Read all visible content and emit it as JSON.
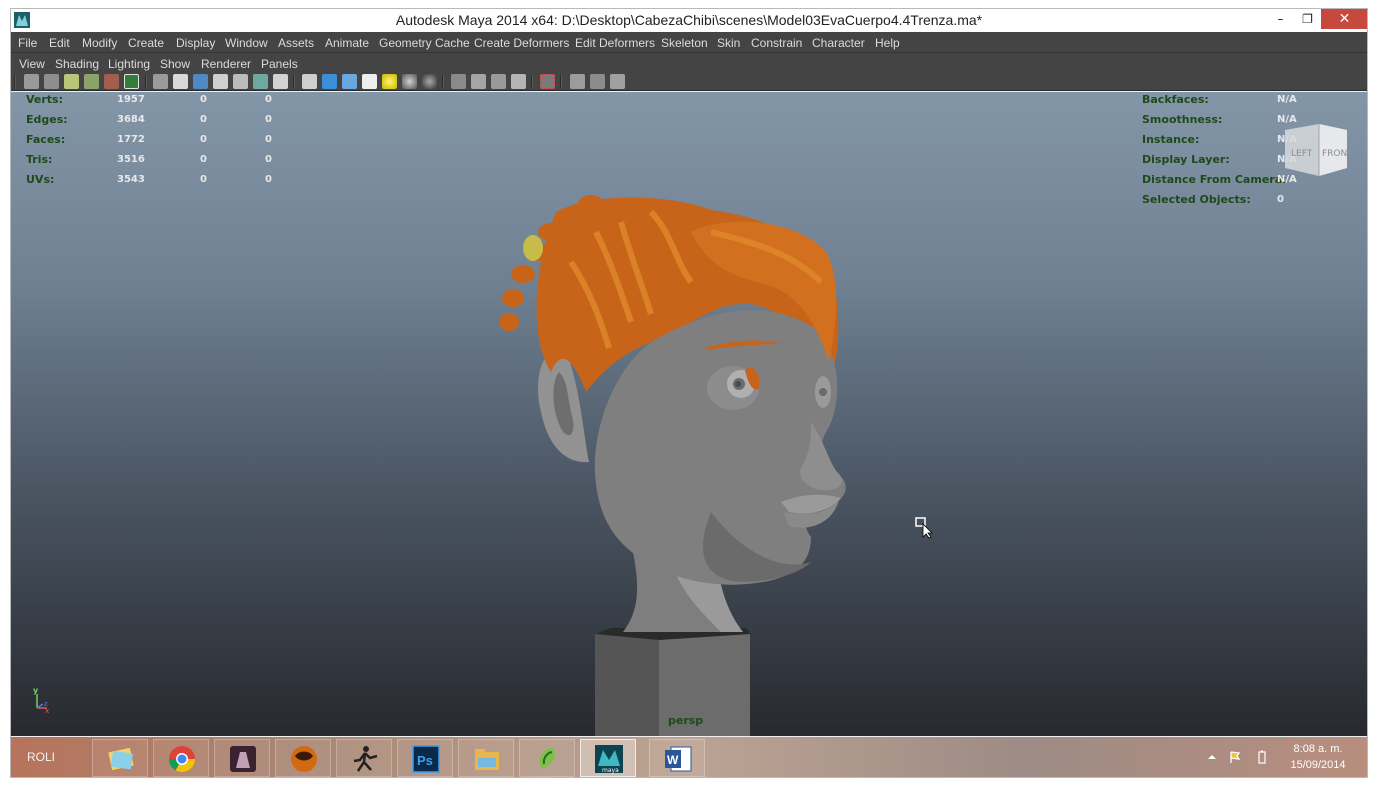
{
  "window": {
    "title": "Autodesk Maya 2014 x64: D:\\Desktop\\CabezaChibi\\scenes\\Model03EvaCuerpo4.4Trenza.ma*",
    "minimize": "–",
    "maximize": "❐",
    "close": "✕"
  },
  "menubar": {
    "items": [
      "File",
      "Edit",
      "Modify",
      "Create",
      "Display",
      "Window",
      "Assets",
      "Animate",
      "Geometry Cache",
      "Create Deformers",
      "Edit Deformers",
      "Skeleton",
      "Skin",
      "Constrain",
      "Character",
      "Help"
    ]
  },
  "panel_menu": {
    "items": [
      "View",
      "Shading",
      "Lighting",
      "Show",
      "Renderer",
      "Panels"
    ]
  },
  "hud_left": {
    "rows": [
      {
        "label": "Verts:",
        "v1": "1957",
        "v2": "0",
        "v3": "0"
      },
      {
        "label": "Edges:",
        "v1": "3684",
        "v2": "0",
        "v3": "0"
      },
      {
        "label": "Faces:",
        "v1": "1772",
        "v2": "0",
        "v3": "0"
      },
      {
        "label": "Tris:",
        "v1": "3516",
        "v2": "0",
        "v3": "0"
      },
      {
        "label": "UVs:",
        "v1": "3543",
        "v2": "0",
        "v3": "0"
      }
    ]
  },
  "hud_right": {
    "rows": [
      {
        "label": "Backfaces:",
        "value": "N/A"
      },
      {
        "label": "Smoothness:",
        "value": "N/A"
      },
      {
        "label": "Instance:",
        "value": "N/A"
      },
      {
        "label": "Display Layer:",
        "value": "N/A"
      },
      {
        "label": "Distance From Camera:",
        "value": "N/A"
      },
      {
        "label": "Selected Objects:",
        "value": "0"
      }
    ]
  },
  "viewcube": {
    "left": "LEFT",
    "front": "FRONT"
  },
  "axis": {
    "y": "y",
    "x": "x",
    "z": "z"
  },
  "viewport": {
    "camera": "persp"
  },
  "taskbar": {
    "label": "ROLI",
    "apps": [
      "file-explorer-icon",
      "chrome-icon",
      "game-icon",
      "mortal-kombat-icon",
      "zbrush-icon",
      "photoshop-icon",
      "folder-icon",
      "corel-icon",
      "maya-icon",
      "word-icon"
    ],
    "active_app": "maya-icon",
    "ps_label": "Ps",
    "word_label": "W",
    "maya_label": "maya",
    "time": "8:08 a. m.",
    "date": "15/09/2014"
  },
  "colors": {
    "hud_text": "#1e4a18",
    "hair": "#c8641a",
    "skin": "#8a8a8a",
    "menubar": "#444444",
    "close_button": "#c7483c"
  }
}
